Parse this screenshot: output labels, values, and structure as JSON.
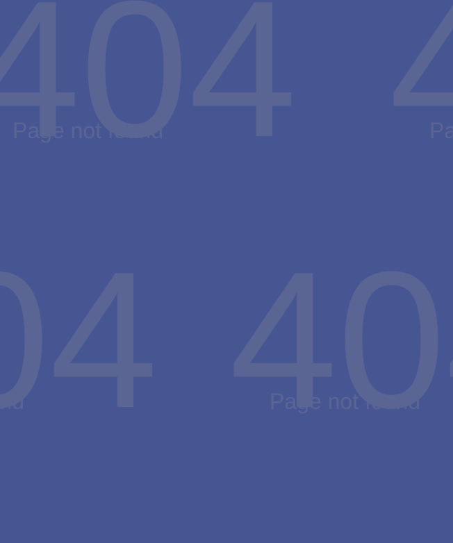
{
  "page": {
    "background_color": "#465692",
    "text_color": "#5a6594",
    "error_code": "404",
    "message": "Page not found"
  }
}
